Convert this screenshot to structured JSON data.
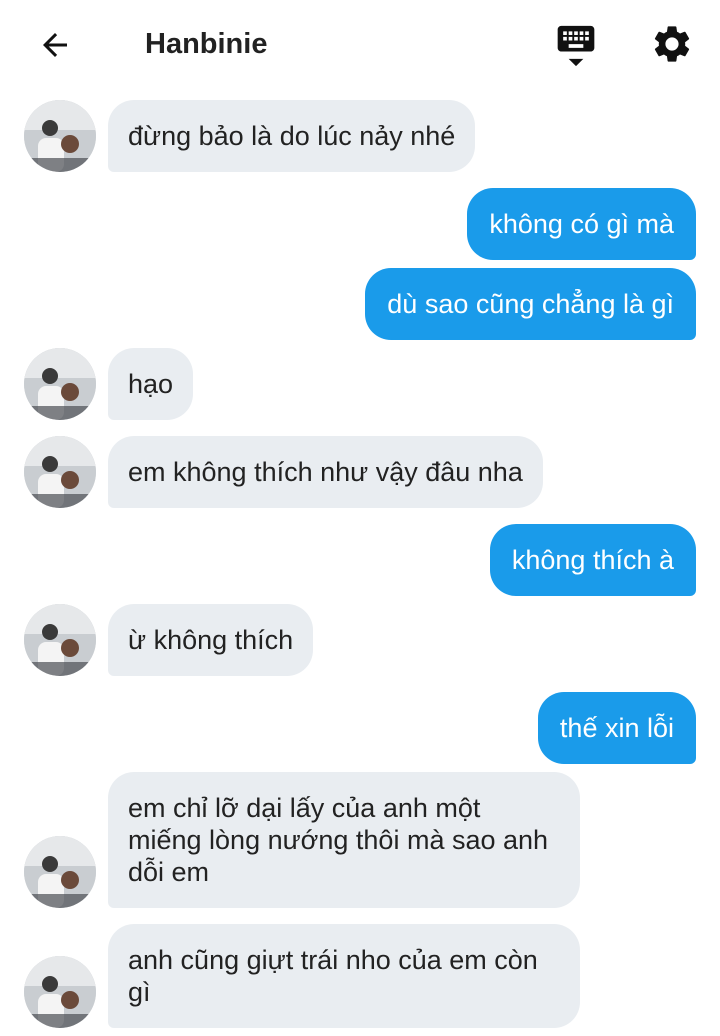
{
  "header": {
    "title": "Hanbinie",
    "back_icon": "arrow-left-icon",
    "keyboard_icon": "keyboard-icon",
    "settings_icon": "gear-icon"
  },
  "colors": {
    "incoming_bubble": "#e9edf1",
    "outgoing_bubble": "#1a9bea",
    "text": "#222222"
  },
  "messages": [
    {
      "side": "in",
      "text": "đừng bảo là do lúc nảy nhé"
    },
    {
      "side": "out",
      "text": "không có gì mà"
    },
    {
      "side": "out",
      "text": "dù sao cũng chẳng là gì"
    },
    {
      "side": "in",
      "text": "hạo"
    },
    {
      "side": "in",
      "text": "em không thích như vậy đâu nha"
    },
    {
      "side": "out",
      "text": "không thích à"
    },
    {
      "side": "in",
      "text": "ừ không thích"
    },
    {
      "side": "out",
      "text": "thế xin lỗi"
    },
    {
      "side": "in",
      "text": "em chỉ lỡ dại lấy của anh một miếng lòng nướng thôi mà sao anh dỗi em"
    },
    {
      "side": "in",
      "text": "anh cũng giựt trái nho của em còn gì"
    }
  ]
}
